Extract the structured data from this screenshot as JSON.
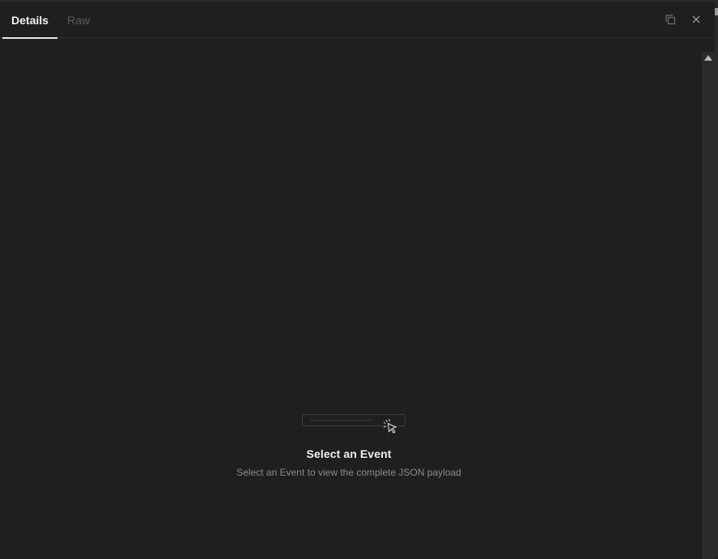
{
  "tabs": [
    {
      "label": "Details",
      "active": true
    },
    {
      "label": "Raw",
      "active": false
    }
  ],
  "toolbar": {
    "copy_icon": "copy-icon",
    "close_icon": "close-icon"
  },
  "empty_state": {
    "title": "Select an Event",
    "subtitle": "Select an Event to view the complete JSON payload",
    "icon": "cursor-click-icon"
  },
  "colors": {
    "background": "#1f1f1f",
    "active_tab": "#f2f2f2",
    "inactive_tab": "#5c5c5c",
    "muted_text": "#8b8b8b"
  }
}
